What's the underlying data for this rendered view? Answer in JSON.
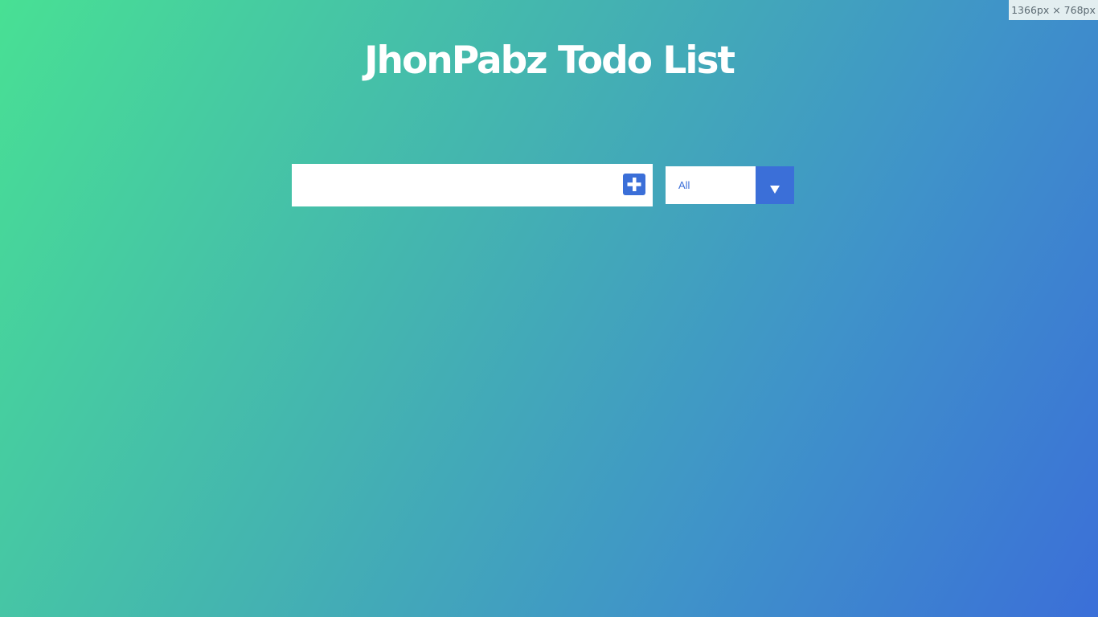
{
  "viewport_badge": "1366px × 768px",
  "header": {
    "title": "JhonPabz Todo List"
  },
  "form": {
    "todo_input": {
      "value": "",
      "placeholder": ""
    },
    "add_button": {
      "icon": "plus-square-icon"
    },
    "filter": {
      "selected": "All",
      "icon": "triangle-down-icon"
    }
  },
  "colors": {
    "accent": "#3b6fd8",
    "gradient_start": "#48e094",
    "gradient_end": "#3b6fd8",
    "title_text": "#ffffff"
  }
}
